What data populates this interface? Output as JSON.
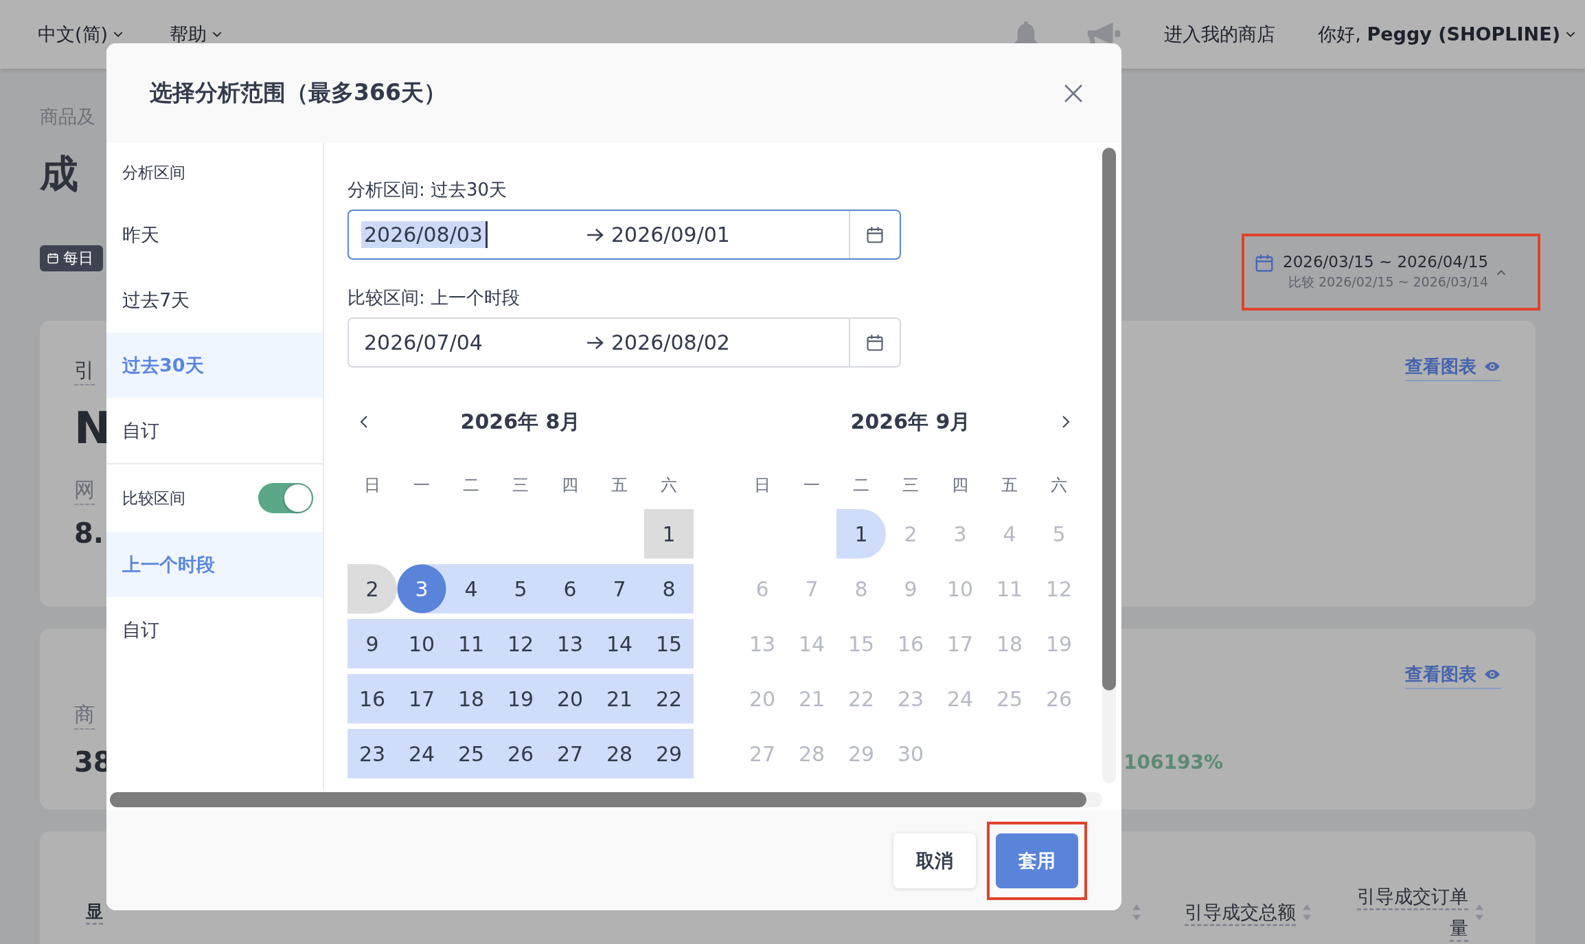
{
  "topbar": {
    "language": "中文(简)",
    "help": "帮助",
    "store_link": "进入我的商店",
    "greeting": "你好, **Peggy (SHOPLINE)**"
  },
  "page": {
    "breadcrumb": "商品及",
    "title": "成",
    "update_tag": "每日",
    "date_button": {
      "range": "2026/03/15 ~ 2026/04/15",
      "compare": "比较 2026/02/15 ~ 2026/03/14",
      "annotated": true
    },
    "cards": [
      {
        "label": "引",
        "value": "N",
        "sublabel": "网",
        "subvalue": "8.",
        "link": "查看图表"
      },
      {
        "label": "商",
        "value": "38",
        "change": "106193%",
        "link": "查看图表"
      }
    ],
    "table": {
      "first_header": "显",
      "columns": [
        {
          "label": "引导成交总额"
        },
        {
          "label": "引导成交订单量"
        }
      ]
    }
  },
  "modal": {
    "title": "选择分析范围（最多366天）",
    "sidebar": [
      {
        "kind": "heading",
        "label": "分析区间"
      },
      {
        "kind": "option",
        "label": "昨天",
        "selected": false
      },
      {
        "kind": "option",
        "label": "过去7天",
        "selected": false
      },
      {
        "kind": "option",
        "label": "过去30天",
        "selected": true
      },
      {
        "kind": "option",
        "label": "自订",
        "selected": false
      },
      {
        "kind": "toggle",
        "label": "比较区间",
        "on": true
      },
      {
        "kind": "option",
        "label": "上一个时段",
        "selected": true
      },
      {
        "kind": "option",
        "label": "自订",
        "selected": false
      }
    ],
    "fields": [
      {
        "label": "分析区间: 过去30天",
        "start": "2026/08/03",
        "end": "2026/09/01",
        "focused": true,
        "start_selected": true
      },
      {
        "label": "比较区间: 上一个时段",
        "start": "2026/07/04",
        "end": "2026/08/02",
        "focused": false,
        "start_selected": false
      }
    ],
    "months": [
      {
        "title": "2026年 8月",
        "weekdays": [
          "日",
          "一",
          "二",
          "三",
          "四",
          "五",
          "六"
        ],
        "weeks": [
          [
            {
              "kind": "blank"
            },
            {
              "kind": "blank"
            },
            {
              "kind": "blank"
            },
            {
              "kind": "blank"
            },
            {
              "kind": "blank"
            },
            {
              "kind": "blank"
            },
            {
              "label": "1",
              "kind": "compare"
            }
          ],
          [
            {
              "label": "2",
              "kind": "compare"
            },
            {
              "label": "3",
              "kind": "start"
            },
            {
              "label": "4",
              "kind": "range"
            },
            {
              "label": "5",
              "kind": "range"
            },
            {
              "label": "6",
              "kind": "range"
            },
            {
              "label": "7",
              "kind": "range"
            },
            {
              "label": "8",
              "kind": "range"
            }
          ],
          [
            {
              "label": "9",
              "kind": "range"
            },
            {
              "label": "10",
              "kind": "range"
            },
            {
              "label": "11",
              "kind": "range"
            },
            {
              "label": "12",
              "kind": "range"
            },
            {
              "label": "13",
              "kind": "range"
            },
            {
              "label": "14",
              "kind": "range"
            },
            {
              "label": "15",
              "kind": "range"
            }
          ],
          [
            {
              "label": "16",
              "kind": "range"
            },
            {
              "label": "17",
              "kind": "range"
            },
            {
              "label": "18",
              "kind": "range"
            },
            {
              "label": "19",
              "kind": "range"
            },
            {
              "label": "20",
              "kind": "range"
            },
            {
              "label": "21",
              "kind": "range"
            },
            {
              "label": "22",
              "kind": "range"
            }
          ],
          [
            {
              "label": "23",
              "kind": "range"
            },
            {
              "label": "24",
              "kind": "range"
            },
            {
              "label": "25",
              "kind": "range"
            },
            {
              "label": "26",
              "kind": "range"
            },
            {
              "label": "27",
              "kind": "range"
            },
            {
              "label": "28",
              "kind": "range"
            },
            {
              "label": "29",
              "kind": "range"
            }
          ]
        ]
      },
      {
        "title": "2026年 9月",
        "weekdays": [
          "日",
          "一",
          "二",
          "三",
          "四",
          "五",
          "六"
        ],
        "weeks": [
          [
            {
              "kind": "blank"
            },
            {
              "kind": "blank"
            },
            {
              "label": "1",
              "kind": "range"
            },
            {
              "label": "2",
              "kind": "disabled"
            },
            {
              "label": "3",
              "kind": "disabled"
            },
            {
              "label": "4",
              "kind": "disabled"
            },
            {
              "label": "5",
              "kind": "disabled"
            }
          ],
          [
            {
              "label": "6",
              "kind": "disabled"
            },
            {
              "label": "7",
              "kind": "disabled"
            },
            {
              "label": "8",
              "kind": "disabled"
            },
            {
              "label": "9",
              "kind": "disabled"
            },
            {
              "label": "10",
              "kind": "disabled"
            },
            {
              "label": "11",
              "kind": "disabled"
            },
            {
              "label": "12",
              "kind": "disabled"
            }
          ],
          [
            {
              "label": "13",
              "kind": "disabled"
            },
            {
              "label": "14",
              "kind": "disabled"
            },
            {
              "label": "15",
              "kind": "disabled"
            },
            {
              "label": "16",
              "kind": "disabled"
            },
            {
              "label": "17",
              "kind": "disabled"
            },
            {
              "label": "18",
              "kind": "disabled"
            },
            {
              "label": "19",
              "kind": "disabled"
            }
          ],
          [
            {
              "label": "20",
              "kind": "disabled"
            },
            {
              "label": "21",
              "kind": "disabled"
            },
            {
              "label": "22",
              "kind": "disabled"
            },
            {
              "label": "23",
              "kind": "disabled"
            },
            {
              "label": "24",
              "kind": "disabled"
            },
            {
              "label": "25",
              "kind": "disabled"
            },
            {
              "label": "26",
              "kind": "disabled"
            }
          ],
          [
            {
              "label": "27",
              "kind": "disabled"
            },
            {
              "label": "28",
              "kind": "disabled"
            },
            {
              "label": "29",
              "kind": "disabled"
            },
            {
              "label": "30",
              "kind": "disabled"
            },
            {
              "kind": "blank"
            },
            {
              "kind": "blank"
            },
            {
              "kind": "blank"
            }
          ]
        ]
      }
    ],
    "buttons": [
      {
        "label": "取消",
        "kind": "secondary",
        "annotated": false
      },
      {
        "label": "套用",
        "kind": "primary",
        "annotated": true
      }
    ]
  }
}
